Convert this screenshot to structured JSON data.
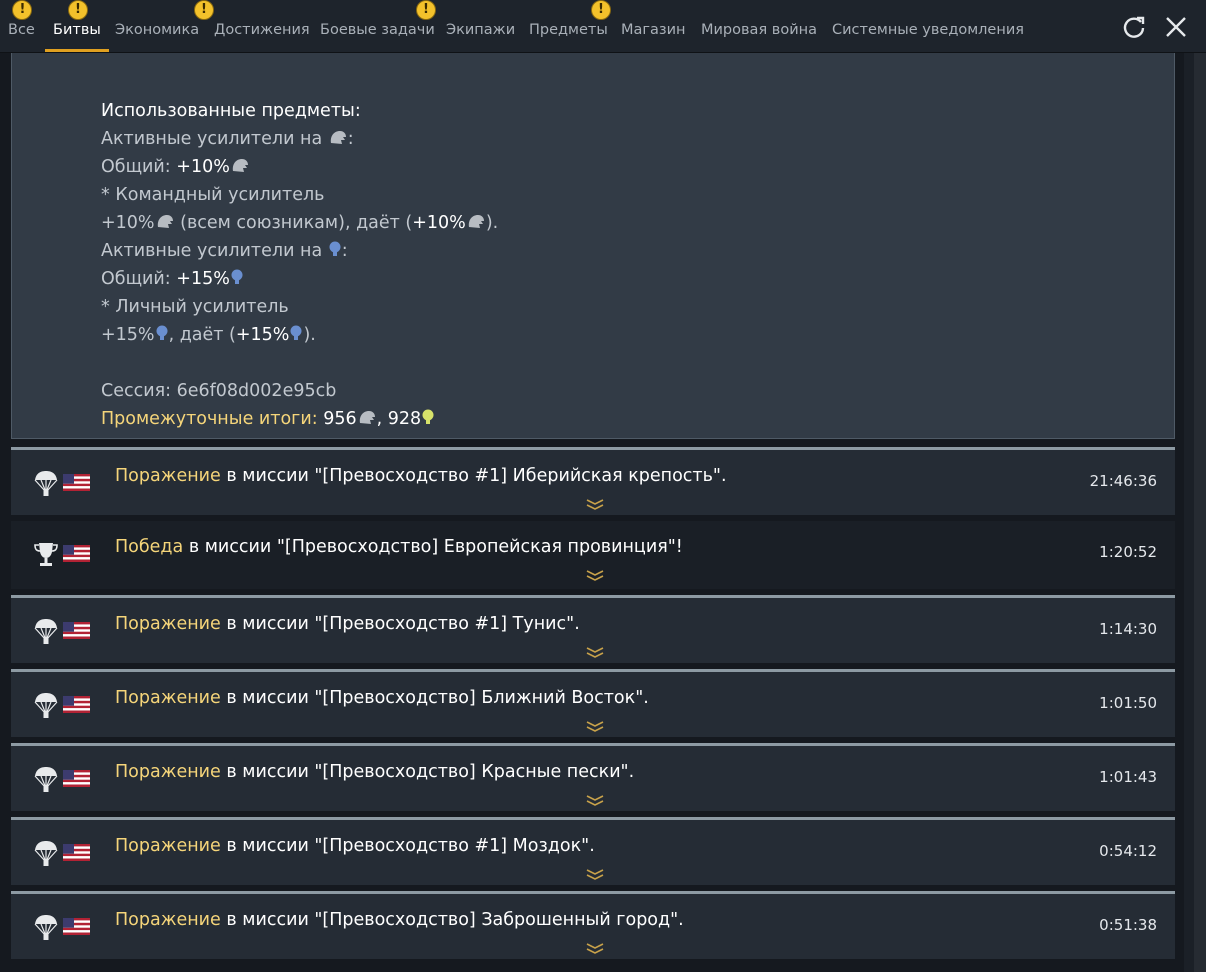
{
  "tabs": [
    {
      "label": "Все",
      "badge": "!"
    },
    {
      "label": "Битвы",
      "badge": "!",
      "active": true
    },
    {
      "label": "Экономика",
      "badge": ""
    },
    {
      "label": "Достижения",
      "badge": "!"
    },
    {
      "label": "Боевые задачи",
      "badge": ""
    },
    {
      "label": "Экипажи",
      "badge": "!"
    },
    {
      "label": "Предметы",
      "badge": ""
    },
    {
      "label": "Магазин",
      "badge": "!"
    },
    {
      "label": "Мировая война",
      "badge": ""
    },
    {
      "label": "Системные уведомления",
      "badge": ""
    }
  ],
  "badge_glyph": "!",
  "toolbar": {
    "refresh_icon": "refresh-icon",
    "close_icon": "close-icon"
  },
  "details": {
    "used_items": "Использованные предметы:",
    "active_boosters_on": "Активные усилители на",
    "colon": ":",
    "total": "Общий:",
    "plus10": "+10%",
    "plus15": "+15%",
    "team_booster": "* Командный усилитель",
    "all_allies": "(всем союзникам), даёт (",
    "gives": ", даёт (",
    "close_paren": ").",
    "personal_booster": "* Личный усилитель",
    "session": "Сессия: 6e6f08d002e95cb",
    "interim_label": "Промежуточные итоги:",
    "interim_sl": "956",
    "comma": ",",
    "interim_rp": "928"
  },
  "battles": [
    {
      "icon": "parachute-icon",
      "result": "Поражение",
      "text": " в миссии \"[Превосходство #1] Иберийская крепость\".",
      "time": "21:46:36",
      "style": "top"
    },
    {
      "icon": "trophy-icon",
      "result": "Победа",
      "text": " в миссии \"[Превосходство] Европейская провинция\"!",
      "time": "1:20:52",
      "style": "dark"
    },
    {
      "icon": "parachute-icon",
      "result": "Поражение",
      "text": " в миссии \"[Превосходство #1] Тунис\".",
      "time": "1:14:30",
      "style": "top"
    },
    {
      "icon": "parachute-icon",
      "result": "Поражение",
      "text": " в миссии \"[Превосходство] Ближний Восток\".",
      "time": "1:01:50",
      "style": "top"
    },
    {
      "icon": "parachute-icon",
      "result": "Поражение",
      "text": " в миссии \"[Превосходство] Красные пески\".",
      "time": "1:01:43",
      "style": "top"
    },
    {
      "icon": "parachute-icon",
      "result": "Поражение",
      "text": " в миссии \"[Превосходство #1] Моздок\".",
      "time": "0:54:12",
      "style": "top"
    },
    {
      "icon": "parachute-icon",
      "result": "Поражение",
      "text": " в миссии \"[Превосходство] Заброшенный город\".",
      "time": "0:51:38",
      "style": "top"
    }
  ],
  "colors": {
    "accent": "#e0a020",
    "result": "#f5d57a",
    "badge": "#f3c12b",
    "rp_icon": "#6a8fd0",
    "rp_icon_total": "#d7e26a"
  }
}
